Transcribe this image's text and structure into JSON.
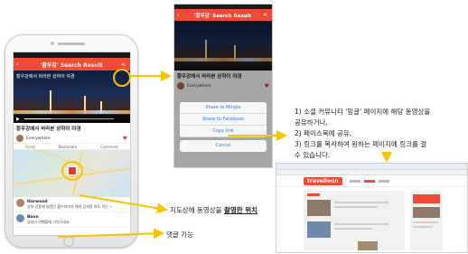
{
  "app": {
    "title": "'황우강' Search Result",
    "video_caption": "황우강에서 바라본 상하이 야경",
    "user_name": "Everywhere",
    "actions": [
      "Good",
      "Bookmark",
      "Comment"
    ],
    "comments": [
      {
        "name": "Harwood",
        "text": "상하 강풍에 날랐던 황우리미가 해외 강처럼 파도 치는 ~"
      },
      {
        "name": "Boon",
        "text": "상하이 여행할때 기억나네요"
      }
    ]
  },
  "share_sheet": {
    "options": [
      "Share to Mingle",
      "Share to Facebook",
      "Copy link"
    ],
    "cancel": "Cancel"
  },
  "browser": {
    "logo": "travelloon"
  },
  "annotations": {
    "share_list": [
      "1) 소셜 커뮤니티 '밍글' 페이지에 해당 동영상을",
      "공유하거나,",
      "2) 페이스북에 공유,",
      "3) 링크를 복사하여 원하는 페이지에 링크를 걸",
      "수 있습니다."
    ],
    "map_pre": "지도상에 동영상을 ",
    "map_bold": "촬영한 위치",
    "comment_label": "댓글 기능"
  },
  "colors": {
    "accent": "#ef4b36",
    "arrow": "#f6c400",
    "link": "#2b7de9"
  }
}
